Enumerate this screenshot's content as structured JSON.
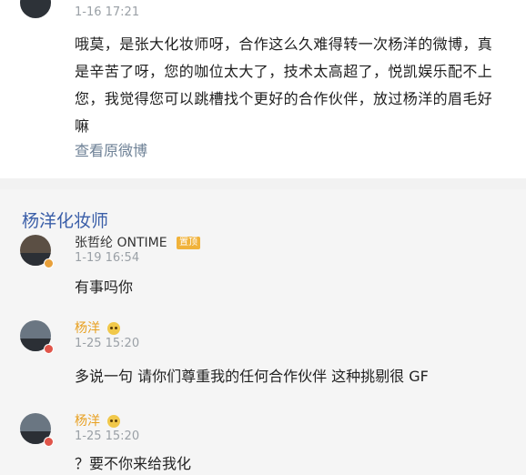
{
  "post": {
    "timestamp": "1-16 17:21",
    "text": "哦莫，是张大化妆师呀，合作这么久难得转一次杨洋的微博，真是辛苦了呀，您的咖位太大了，技术太高超了，悦凯娱乐配不上您，我觉得您可以跳槽找个更好的合作伙伴，放过杨洋的眉毛好嘛",
    "view_original_label": "查看原微博"
  },
  "comments_section": {
    "title": "杨洋化妆师",
    "comments": [
      {
        "author": "张哲纶 ONTIME",
        "badge": "置顶",
        "time": "1-19 16:54",
        "text": "有事吗你"
      },
      {
        "author": "杨洋",
        "time": "1-25 15:20",
        "text": "多说一句 请你们尊重我的任何合作伙伴 这种挑剔很 GF"
      },
      {
        "author": "杨洋",
        "time": "1-25 15:20",
        "text": "？要不你来给我化"
      }
    ]
  },
  "colors": {
    "link": "#6e8196",
    "title_blue": "#3a5ea8",
    "gold_name": "#e8a020",
    "gray_time": "#9aa0a6"
  }
}
